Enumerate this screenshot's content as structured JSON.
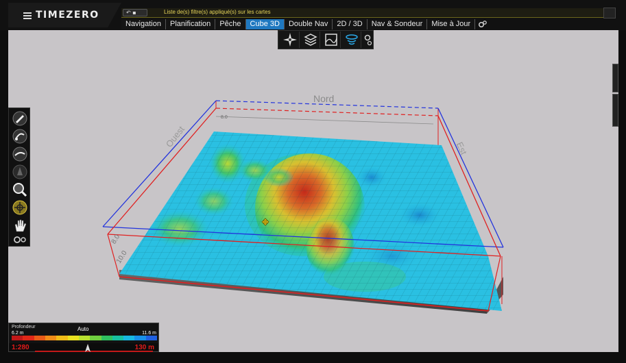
{
  "app": {
    "name": "TIMEZERO"
  },
  "filter": {
    "text": "Liste de(s) filtre(s) appliqué(s) sur les cartes",
    "undo_icon": "undo-arrow-icon"
  },
  "tabs": [
    {
      "label": "Navigation",
      "active": false
    },
    {
      "label": "Planification",
      "active": false
    },
    {
      "label": "Pêche",
      "active": false
    },
    {
      "label": "Cube 3D",
      "active": true
    },
    {
      "label": "Double Nav",
      "active": false
    },
    {
      "label": "2D / 3D",
      "active": false
    },
    {
      "label": "Nav & Sondeur",
      "active": false
    },
    {
      "label": "Mise à Jour",
      "active": false
    }
  ],
  "scene": {
    "compass": {
      "north": "Nord",
      "west": "Ouest",
      "east": "Est"
    },
    "depth_top_back": "8.0",
    "depth_front_a": "8.0",
    "depth_front_b": "10.0",
    "colors": {
      "box_top": "#2233dd",
      "box_bottom": "#e02020",
      "terrain_peak": "#c83a20",
      "terrain_low": "#2bc4e0"
    }
  },
  "legend": {
    "label": "Profondeur",
    "mode": "Auto",
    "min": "6.2 m",
    "max": "11.6 m",
    "ramp": [
      "#c01818",
      "#e02818",
      "#e85a18",
      "#f08c18",
      "#f0bc18",
      "#e8e020",
      "#b8e030",
      "#70d040",
      "#30c060",
      "#18c0a0",
      "#18b8e0",
      "#1890e8",
      "#2060e0"
    ]
  },
  "scale": {
    "ratio": "1:280",
    "distance": "130 m"
  },
  "toolbars": {
    "view3d": [
      "compass-rose-icon",
      "depth-layers-icon",
      "terrain-grid-icon",
      "sonar-icon",
      "gear-icon"
    ],
    "left": [
      "edit-route-icon",
      "anchor-route-icon",
      "cursor-route-icon",
      "boat-icon",
      "zoom-lens-icon",
      "crosshair-icon",
      "hand-pan-icon",
      "gear-icon"
    ]
  }
}
